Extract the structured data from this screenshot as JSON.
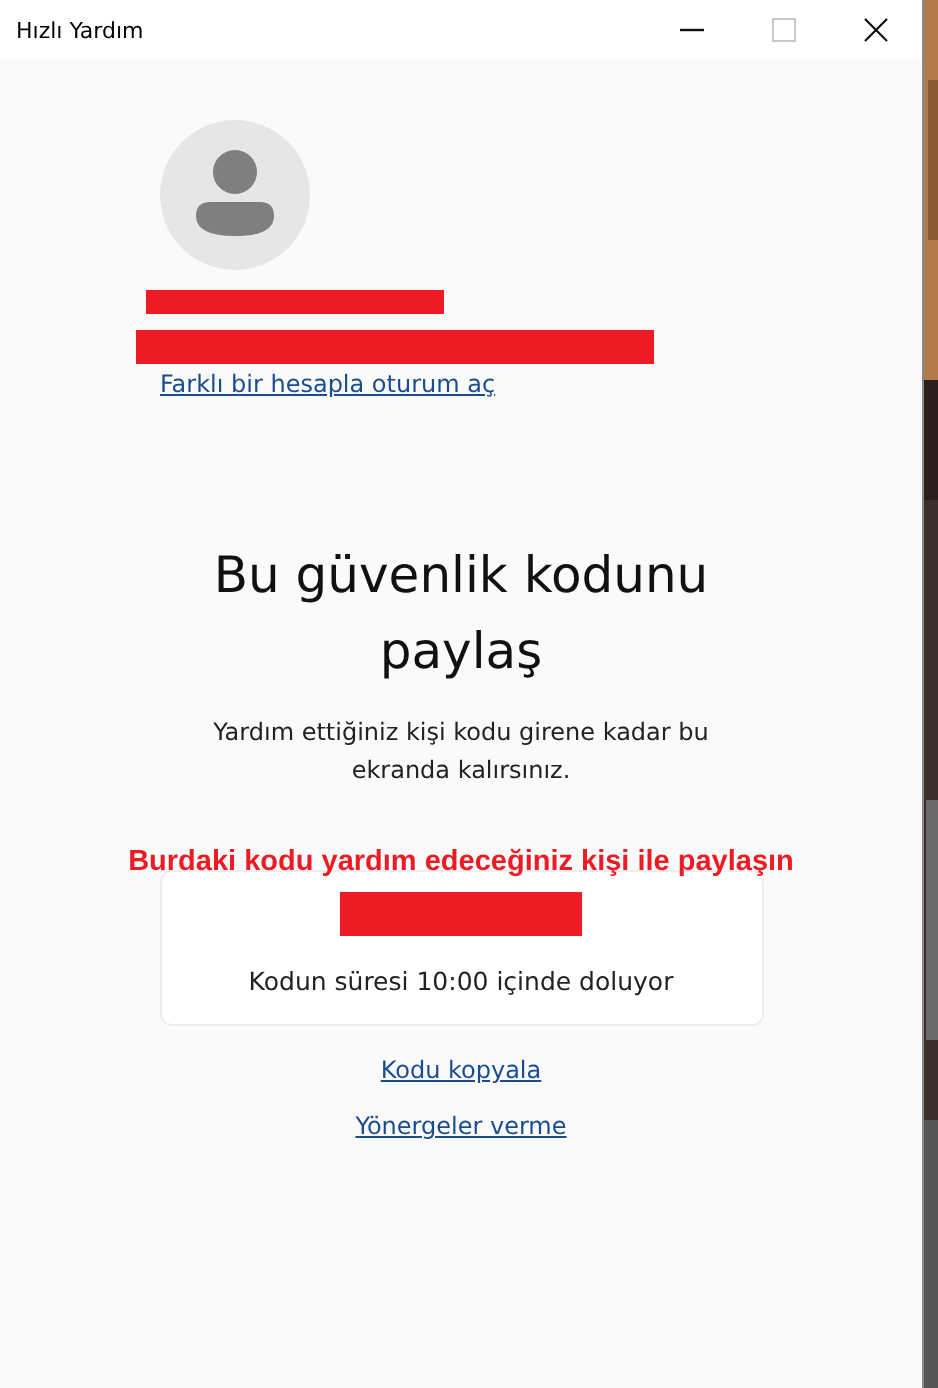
{
  "window": {
    "title": "Hızlı Yardım",
    "controls": [
      {
        "kind": "minimize",
        "disabled": false
      },
      {
        "kind": "maximize",
        "disabled": true
      },
      {
        "kind": "close",
        "disabled": false
      }
    ]
  },
  "account": {
    "switch_link": "Farklı bir hesapla oturum aç"
  },
  "heading": "Bu güvenlik kodunu paylaş",
  "description": "Yardım ettiğiniz kişi kodu girene kadar bu ekranda kalırsınız.",
  "annotation": "Burdaki kodu yardım edeceğiniz kişi ile paylaşın",
  "code_card": {
    "expiry": "Kodun süresi 10:00 içinde doluyor"
  },
  "links": [
    "Kodu kopyala",
    "Yönergeler verme"
  ]
}
